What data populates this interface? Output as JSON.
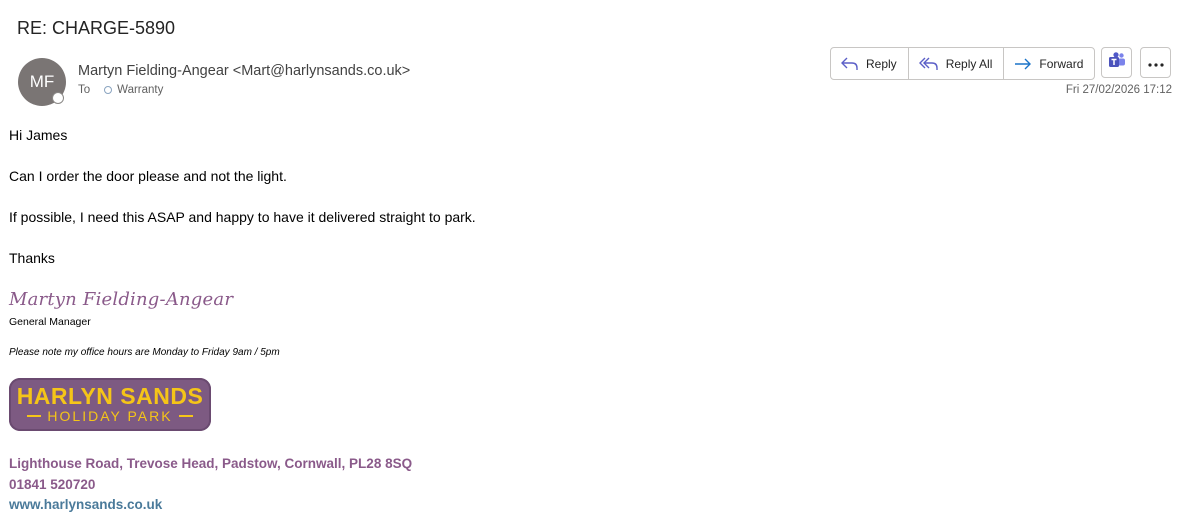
{
  "subject": "RE: CHARGE-5890",
  "sender": {
    "initials": "MF",
    "display": "Martyn Fielding-Angear <Mart@harlynsands.co.uk>",
    "to_label": "To",
    "recipient": "Warranty"
  },
  "actions": {
    "reply": "Reply",
    "reply_all": "Reply All",
    "forward": "Forward"
  },
  "date": "Fri 27/02/2026 17:12",
  "body": {
    "greeting": "Hi James",
    "line1": "Can I order the door please and not the light.",
    "line2": "If possible, I need this ASAP and happy to have it delivered straight to park.",
    "closing": "Thanks"
  },
  "signature": {
    "name": "Martyn Fielding-Angear",
    "title": "General Manager",
    "hours": "Please note my office hours are Monday to Friday 9am / 5pm",
    "logo_main": "HARLYN SANDS",
    "logo_sub": "HOLIDAY PARK",
    "address": "Lighthouse Road, Trevose Head, Padstow, Cornwall, PL28 8SQ",
    "phone": "01841 520720",
    "website": "www.harlynsands.co.uk"
  },
  "icons": {
    "reply": "reply-icon",
    "reply_all": "reply-all-icon",
    "forward": "forward-icon",
    "teams": "teams-icon",
    "more": "more-icon"
  },
  "colors": {
    "brand_purple": "#7d5a82",
    "brand_yellow": "#f5c518",
    "forward_blue": "#1a73c8"
  }
}
